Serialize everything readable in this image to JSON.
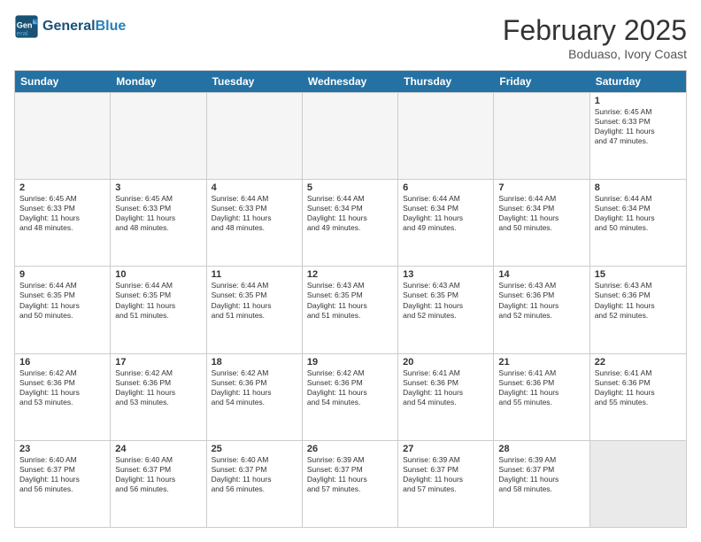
{
  "header": {
    "logo_line1": "General",
    "logo_line2": "Blue",
    "month": "February 2025",
    "location": "Boduaso, Ivory Coast"
  },
  "weekdays": [
    "Sunday",
    "Monday",
    "Tuesday",
    "Wednesday",
    "Thursday",
    "Friday",
    "Saturday"
  ],
  "rows": [
    [
      {
        "day": "",
        "text": ""
      },
      {
        "day": "",
        "text": ""
      },
      {
        "day": "",
        "text": ""
      },
      {
        "day": "",
        "text": ""
      },
      {
        "day": "",
        "text": ""
      },
      {
        "day": "",
        "text": ""
      },
      {
        "day": "1",
        "text": "Sunrise: 6:45 AM\nSunset: 6:33 PM\nDaylight: 11 hours\nand 47 minutes."
      }
    ],
    [
      {
        "day": "2",
        "text": "Sunrise: 6:45 AM\nSunset: 6:33 PM\nDaylight: 11 hours\nand 48 minutes."
      },
      {
        "day": "3",
        "text": "Sunrise: 6:45 AM\nSunset: 6:33 PM\nDaylight: 11 hours\nand 48 minutes."
      },
      {
        "day": "4",
        "text": "Sunrise: 6:44 AM\nSunset: 6:33 PM\nDaylight: 11 hours\nand 48 minutes."
      },
      {
        "day": "5",
        "text": "Sunrise: 6:44 AM\nSunset: 6:34 PM\nDaylight: 11 hours\nand 49 minutes."
      },
      {
        "day": "6",
        "text": "Sunrise: 6:44 AM\nSunset: 6:34 PM\nDaylight: 11 hours\nand 49 minutes."
      },
      {
        "day": "7",
        "text": "Sunrise: 6:44 AM\nSunset: 6:34 PM\nDaylight: 11 hours\nand 50 minutes."
      },
      {
        "day": "8",
        "text": "Sunrise: 6:44 AM\nSunset: 6:34 PM\nDaylight: 11 hours\nand 50 minutes."
      }
    ],
    [
      {
        "day": "9",
        "text": "Sunrise: 6:44 AM\nSunset: 6:35 PM\nDaylight: 11 hours\nand 50 minutes."
      },
      {
        "day": "10",
        "text": "Sunrise: 6:44 AM\nSunset: 6:35 PM\nDaylight: 11 hours\nand 51 minutes."
      },
      {
        "day": "11",
        "text": "Sunrise: 6:44 AM\nSunset: 6:35 PM\nDaylight: 11 hours\nand 51 minutes."
      },
      {
        "day": "12",
        "text": "Sunrise: 6:43 AM\nSunset: 6:35 PM\nDaylight: 11 hours\nand 51 minutes."
      },
      {
        "day": "13",
        "text": "Sunrise: 6:43 AM\nSunset: 6:35 PM\nDaylight: 11 hours\nand 52 minutes."
      },
      {
        "day": "14",
        "text": "Sunrise: 6:43 AM\nSunset: 6:36 PM\nDaylight: 11 hours\nand 52 minutes."
      },
      {
        "day": "15",
        "text": "Sunrise: 6:43 AM\nSunset: 6:36 PM\nDaylight: 11 hours\nand 52 minutes."
      }
    ],
    [
      {
        "day": "16",
        "text": "Sunrise: 6:42 AM\nSunset: 6:36 PM\nDaylight: 11 hours\nand 53 minutes."
      },
      {
        "day": "17",
        "text": "Sunrise: 6:42 AM\nSunset: 6:36 PM\nDaylight: 11 hours\nand 53 minutes."
      },
      {
        "day": "18",
        "text": "Sunrise: 6:42 AM\nSunset: 6:36 PM\nDaylight: 11 hours\nand 54 minutes."
      },
      {
        "day": "19",
        "text": "Sunrise: 6:42 AM\nSunset: 6:36 PM\nDaylight: 11 hours\nand 54 minutes."
      },
      {
        "day": "20",
        "text": "Sunrise: 6:41 AM\nSunset: 6:36 PM\nDaylight: 11 hours\nand 54 minutes."
      },
      {
        "day": "21",
        "text": "Sunrise: 6:41 AM\nSunset: 6:36 PM\nDaylight: 11 hours\nand 55 minutes."
      },
      {
        "day": "22",
        "text": "Sunrise: 6:41 AM\nSunset: 6:36 PM\nDaylight: 11 hours\nand 55 minutes."
      }
    ],
    [
      {
        "day": "23",
        "text": "Sunrise: 6:40 AM\nSunset: 6:37 PM\nDaylight: 11 hours\nand 56 minutes."
      },
      {
        "day": "24",
        "text": "Sunrise: 6:40 AM\nSunset: 6:37 PM\nDaylight: 11 hours\nand 56 minutes."
      },
      {
        "day": "25",
        "text": "Sunrise: 6:40 AM\nSunset: 6:37 PM\nDaylight: 11 hours\nand 56 minutes."
      },
      {
        "day": "26",
        "text": "Sunrise: 6:39 AM\nSunset: 6:37 PM\nDaylight: 11 hours\nand 57 minutes."
      },
      {
        "day": "27",
        "text": "Sunrise: 6:39 AM\nSunset: 6:37 PM\nDaylight: 11 hours\nand 57 minutes."
      },
      {
        "day": "28",
        "text": "Sunrise: 6:39 AM\nSunset: 6:37 PM\nDaylight: 11 hours\nand 58 minutes."
      },
      {
        "day": "",
        "text": ""
      }
    ]
  ]
}
